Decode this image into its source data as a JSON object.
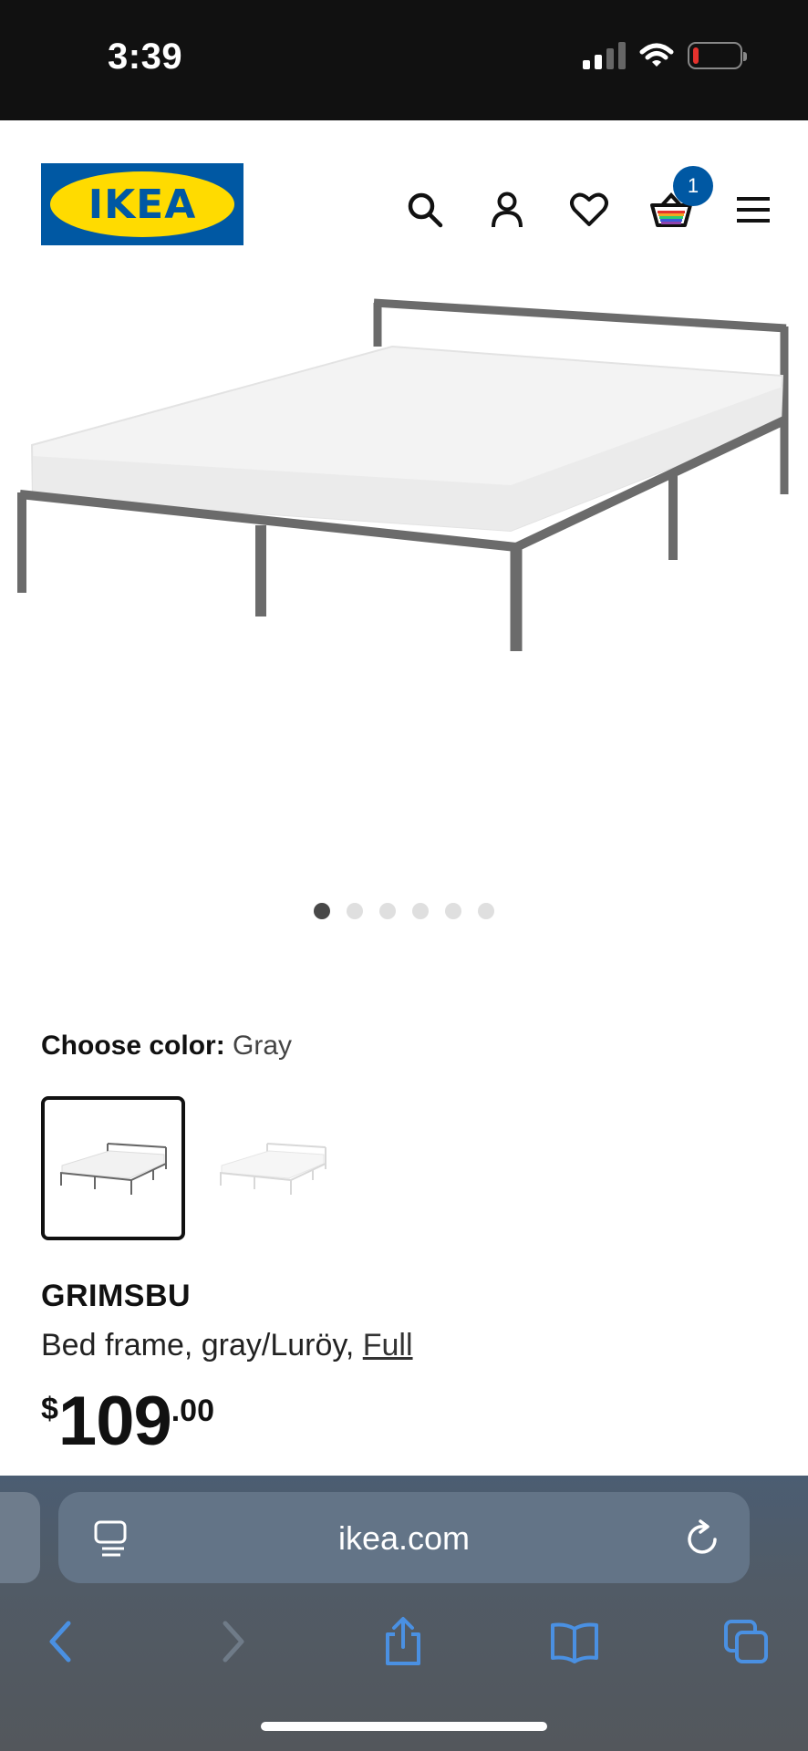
{
  "status_bar": {
    "time": "3:39",
    "icons": [
      "cellular-signal-icon",
      "wifi-icon",
      "battery-low-icon"
    ]
  },
  "header": {
    "logo_text": "IKEA",
    "icons": [
      "search-icon",
      "account-icon",
      "wishlist-heart-icon",
      "shopping-basket-icon",
      "menu-icon"
    ],
    "cart_count": "1",
    "brand_blue": "#0058a3",
    "brand_yellow": "#ffdb00"
  },
  "gallery": {
    "image_count": 6,
    "active_index": 0
  },
  "color_choice": {
    "label": "Choose color:",
    "value": "Gray",
    "options": [
      "Gray",
      "White"
    ],
    "selected": "Gray"
  },
  "product": {
    "name": "GRIMSBU",
    "description": "Bed frame, gray/Luröy, ",
    "size_link": "Full",
    "price_currency": "$",
    "price_integer": "109",
    "price_decimals": ".00"
  },
  "browser": {
    "url": "ikea.com",
    "icons": [
      "reader-view-icon",
      "reload-icon",
      "back-icon",
      "forward-icon",
      "share-icon",
      "bookmarks-icon",
      "tabs-icon"
    ],
    "accent": "#4a90e2"
  }
}
